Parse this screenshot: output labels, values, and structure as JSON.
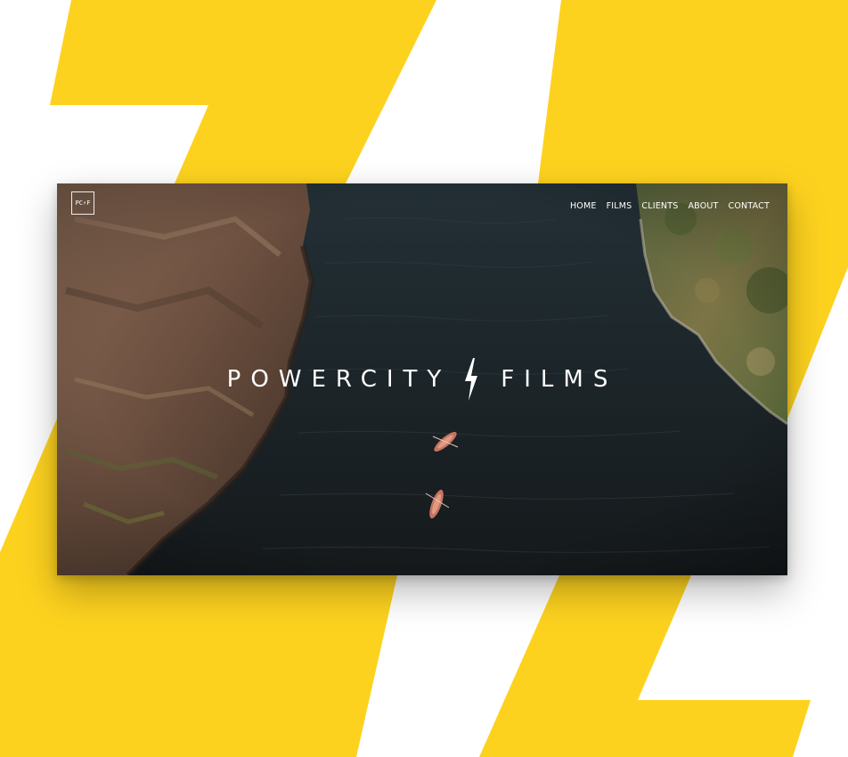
{
  "colors": {
    "accent_yellow": "#FDD21F",
    "water": "#1c2428",
    "text": "#ffffff"
  },
  "logo": {
    "text": "PC⚡F"
  },
  "nav": {
    "items": [
      "HOME",
      "FILMS",
      "CLIENTS",
      "ABOUT",
      "CONTACT"
    ]
  },
  "hero": {
    "title_left": "POWERCITY",
    "title_right": "FILMS",
    "divider_icon": "lightning-bolt-icon"
  }
}
